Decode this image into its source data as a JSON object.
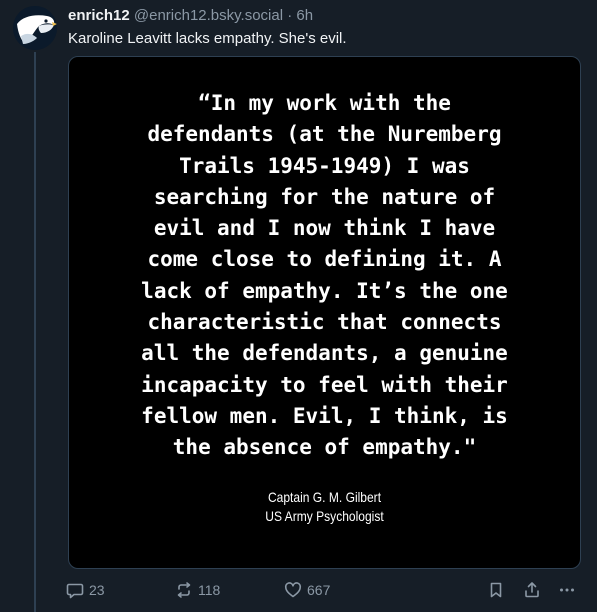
{
  "post": {
    "display_name": "enrich12",
    "handle": "@enrich12.bsky.social",
    "separator": "·",
    "time": "6h",
    "text": "Karoline Leavitt lacks empathy. She's evil."
  },
  "image": {
    "quote_lines": [
      "“In my work with the",
      "defendants (at the Nuremberg",
      "Trails 1945-1949) I was",
      "searching for the nature of",
      "evil and I now think I have",
      "come close to defining it. A",
      "lack of empathy. It’s the one",
      "characteristic that connects",
      "all the defendants, a genuine",
      "incapacity to feel with their",
      "fellow men. Evil, I think, is",
      "the absence of empathy.\""
    ],
    "attribution_name": "Captain G. M. Gilbert",
    "attribution_title": "US Army Psychologist"
  },
  "actions": {
    "reply_count": "23",
    "repost_count": "118",
    "like_count": "667"
  },
  "icons": {
    "reply": "speech-bubble-icon",
    "repost": "repost-arrows-icon",
    "like": "heart-outline-icon",
    "bookmark": "bookmark-icon",
    "share": "share-upload-icon",
    "more": "ellipsis-icon"
  },
  "colors": {
    "background": "#161e27",
    "text_primary": "#f1f3f5",
    "text_secondary": "#8b98a5",
    "border": "#2e4052",
    "image_background": "#000000"
  }
}
